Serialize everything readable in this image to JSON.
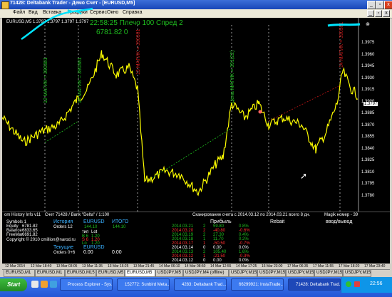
{
  "window": {
    "title": "71428: Deltabank Trader - Демо Счет - [EURUSD,M5]",
    "controls": {
      "minimize": "_",
      "restore": "▫",
      "close": "x"
    }
  },
  "menu": [
    "Файл",
    "Вид",
    "Вставка",
    "Графики",
    "Сервис",
    "Окно",
    "Справка"
  ],
  "chart": {
    "symbol_header": "EURUSD,M5  1.3797 1.3797 1.3797 1.3797",
    "overlay_line1": "22:58:25  Плечо 100  Спред 2",
    "overlay_line2": "6781.82   0",
    "vertical_labels": [
      {
        "text": "12 МАГИК = 390381",
        "color": "#1fbf1f"
      },
      {
        "text": "16 МАГИК = 390381",
        "color": "#1fbf1f"
      },
      {
        "text": "13 МАГИК = 390381",
        "color": "#c01515"
      },
      {
        "text": "Цена МАГИК = 391(22)",
        "color": "#1fbf1f"
      },
      {
        "text": "14 МАГИК = 390381",
        "color": "#c01515"
      }
    ],
    "price_scale": [
      "1.3975",
      "1.3960",
      "1.3945",
      "1.3930",
      "1.3915",
      "1.3900",
      "1.3885",
      "1.3870",
      "1.3855",
      "1.3840",
      "1.3825",
      "1.3810",
      "1.3795",
      "1.3780"
    ],
    "price_current": "1.3797",
    "colors": {
      "candles": "#ffff00",
      "grid": "#ffffff",
      "green": "#1fbf1f",
      "red": "#c01515"
    }
  },
  "info": {
    "header_left": "om History Info v11",
    "header_account": "Счет 71428 / Bank \"Delta\" / 1:100",
    "header_scan": "Сканирование счета с 2014.03.12 по 2014.03.21 всего 8 дн.",
    "header_magic": "Magik номер - 39",
    "symbols_label": "Symbols 1",
    "equity_label": "Equity",
    "equity": "6781.82",
    "balance_label": "Balance",
    "balance": "6833.65",
    "freemar_label": "FreeMar",
    "freemar": "6691.82",
    "history_label": "История",
    "history_symbol": "EURUSD",
    "history_total_label": "ИТОГО",
    "orders_label": "Orders 12",
    "orders_value": "144.10",
    "orders_total": "144.10",
    "lot_header_left": "тип",
    "lot_header_right": "Lot",
    "lot_rows": [
      [
        "B 6",
        "1.20"
      ],
      [
        "S 6",
        "1.20"
      ],
      [
        "Lo",
        "1.20"
      ]
    ],
    "copyright": "Copyright © 2010 cmillion@narod.ru",
    "current_label": "Текущие",
    "current_symbol": "EURUSD",
    "current_orders": "Orders 0+6",
    "current_value": "0.00",
    "current_total": "0.00",
    "profit_header": "Прибыль",
    "rebate_header": "Rebait",
    "deposit_header": "ввод/вывод",
    "daily": [
      {
        "date": "2014.03.21",
        "n": "2",
        "profit": "59.80",
        "pct": "0.8%",
        "color": "#1fbf1f"
      },
      {
        "date": "2014.03.20",
        "n": "2",
        "profit": "-40.80",
        "pct": "-0.6%",
        "color": "#ff3030"
      },
      {
        "date": "2014.03.19",
        "n": "2",
        "profit": "27.30",
        "pct": "0.4%",
        "color": "#1fbf1f"
      },
      {
        "date": "2014.03.18",
        "n": "1",
        "profit": "11.70",
        "pct": "0.2%",
        "color": "#1fbf1f"
      },
      {
        "date": "2014.03.17",
        "n": "1",
        "profit": "-50.50",
        "pct": "-0.7%",
        "color": "#ff3030"
      },
      {
        "date": "2014.03.14",
        "n": "0",
        "profit": "0.00",
        "pct": "0.0%",
        "color": "#ffffff"
      },
      {
        "date": "2014.03.13",
        "n": "2",
        "profit": "105.40",
        "pct": "1.6%",
        "color": "#1fbf1f"
      },
      {
        "date": "2014.03.12",
        "n": "1",
        "profit": "-21.50",
        "pct": "-0.3%",
        "color": "#ff3030"
      },
      {
        "date": "2014.03.12",
        "n": "0",
        "profit": "0.00",
        "pct": "0.0%",
        "color": "#ffffff"
      }
    ]
  },
  "time_axis": [
    "12 Mar 2014",
    "12 Mar 18:40",
    "13 Mar 03:05",
    "13 Mar 11:35",
    "13 Mar 16:25",
    "13 Mar 21:45",
    "14 Mar 06:10",
    "14 Mar 08:50",
    "14 Mar 12:55",
    "14 Mar 17:25",
    "16 Mar 23:00",
    "17 Mar 06:35",
    "17 Mar 11:55",
    "17 Mar 18:20",
    "17 Mar 23:40"
  ],
  "tabs": [
    "EURUSD,M1",
    "EURUSD,M1",
    "EURUSD,M15",
    "EURUSD,M5",
    "EURUSD,M5",
    "USDJPY,M5",
    "USDJPY,M4 (offline)",
    "USDJPY,M15",
    "USDJPY,M15",
    "USDJPY,M15",
    "USDJPY,M15",
    "USDJPY,M15"
  ],
  "active_tab_index": 4,
  "taskbar": {
    "start": "Start",
    "tasks": [
      "Process Explorer - Sys...",
      "152772: Sunbird Meta...",
      "4283: Deltabank Trad...",
      "66299921: InstaTrade...",
      "71428: Deltabank Trad..."
    ],
    "active_task_index": 4,
    "clock": "22:56"
  }
}
